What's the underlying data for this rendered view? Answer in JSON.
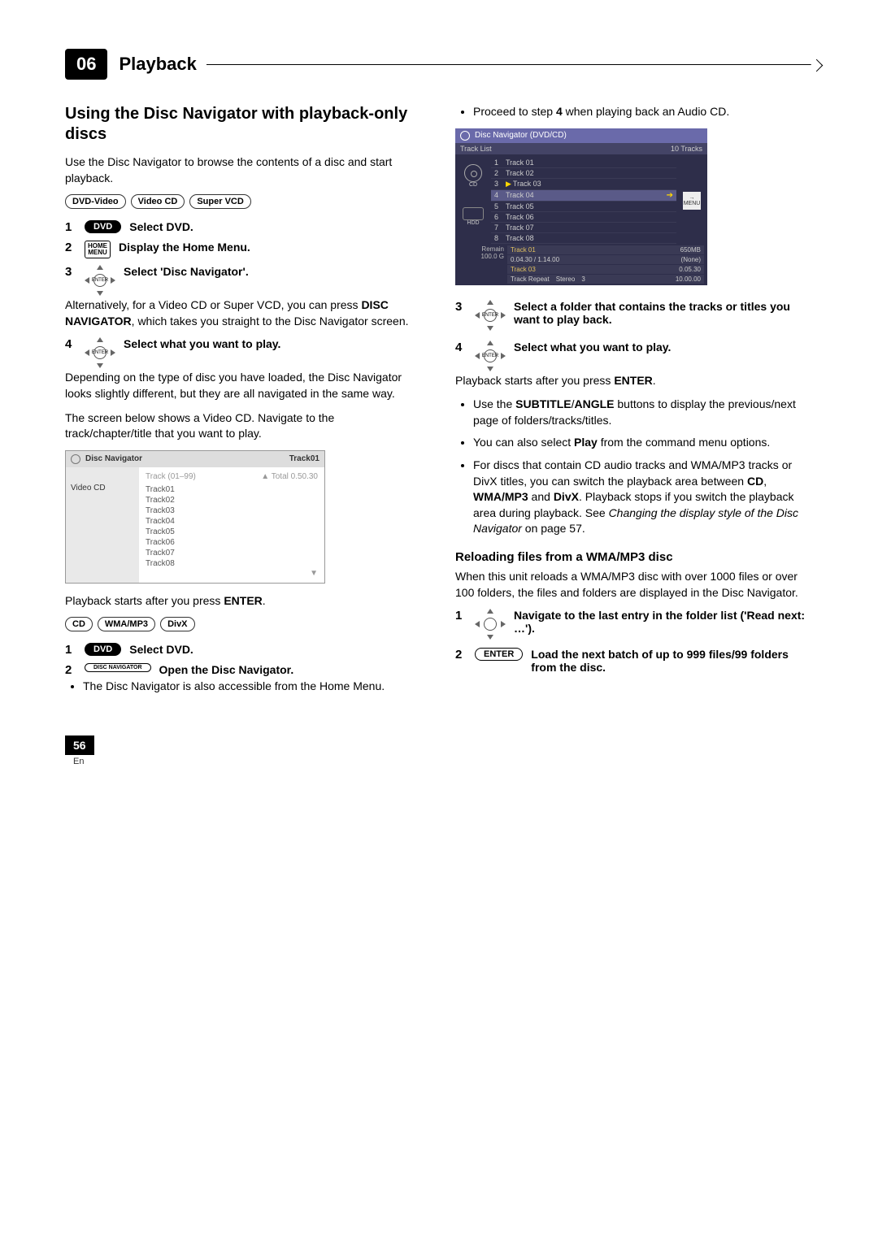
{
  "chapter": {
    "number": "06",
    "title": "Playback"
  },
  "left": {
    "h2": "Using the Disc Navigator with playback-only discs",
    "intro": "Use the Disc Navigator to browse the contents of a disc and start playback.",
    "badges1": [
      "DVD-Video",
      "Video CD",
      "Super VCD"
    ],
    "s1": {
      "num": "1",
      "btn": "DVD",
      "text": "Select DVD."
    },
    "s2": {
      "num": "2",
      "btn": "HOME\nMENU",
      "text": "Display the Home Menu."
    },
    "s3": {
      "num": "3",
      "center": "ENTER",
      "text": "Select 'Disc Navigator'."
    },
    "s3_follow": "Alternatively, for a Video CD or Super VCD, you can press <b>DISC NAVIGATOR</b>, which takes you straight to the Disc Navigator screen.",
    "s4": {
      "num": "4",
      "center": "ENTER",
      "text": "Select what you want to play."
    },
    "s4_follow1": "Depending on the type of disc you have loaded, the Disc Navigator looks slightly different, but they are all navigated in the same way.",
    "s4_follow2": "The screen below shows a Video CD. Navigate to the track/chapter/title that you want to play.",
    "vcd": {
      "header": "Disc Navigator",
      "trk": "Track01",
      "left_label": "Video CD",
      "meta_left": "Track (01–99)",
      "meta_right": "▲  Total 0.50.30",
      "tracks": [
        "Track01",
        "Track02",
        "Track03",
        "Track04",
        "Track05",
        "Track06",
        "Track07",
        "Track08"
      ],
      "down": "▼"
    },
    "after_vcd": "Playback starts after you press <b>ENTER</b>.",
    "badges2": [
      "CD",
      "WMA/MP3",
      "DivX"
    ],
    "s5": {
      "num": "1",
      "btn": "DVD",
      "text": "Select DVD."
    },
    "s6": {
      "num": "2",
      "btn": "DISC NAVIGATOR",
      "text": "Open the Disc Navigator."
    },
    "s6_bullet": "The Disc Navigator is also accessible from the Home Menu."
  },
  "right": {
    "top_bullet": "Proceed to step <b>4</b> when playing back an Audio CD.",
    "dvd": {
      "title": "Disc Navigator (DVD/CD)",
      "sub_left": "Track List",
      "sub_right": "10 Tracks",
      "cd_label": "CD",
      "tracks": [
        {
          "n": "1",
          "t": "Track 01"
        },
        {
          "n": "2",
          "t": "Track 02"
        },
        {
          "n": "3",
          "t": "Track 03",
          "play": true
        },
        {
          "n": "4",
          "t": "Track 04",
          "sel": true
        },
        {
          "n": "5",
          "t": "Track 05"
        },
        {
          "n": "6",
          "t": "Track 06"
        },
        {
          "n": "7",
          "t": "Track 07"
        },
        {
          "n": "8",
          "t": "Track 08"
        }
      ],
      "menu": "MENU",
      "hdd_label": "HDD",
      "foot_l1": "Remain",
      "foot_l2": "100.0 G",
      "foot_r1_a": "Track 01",
      "foot_r1_b": "650MB",
      "foot_r2_a": "0.04.30 / 1.14.00",
      "foot_r2_b": "(None)",
      "foot_r3_a": "Track 03",
      "foot_r3_b": "0.05.30",
      "foot_r4_a": "Track Repeat",
      "foot_r4_b": "Stereo",
      "foot_r4_c": "3",
      "foot_r4_d": "10.00.00"
    },
    "s3r": {
      "num": "3",
      "center": "ENTER",
      "text": "Select a folder that contains the tracks or titles you want to play back."
    },
    "s4r": {
      "num": "4",
      "center": "ENTER",
      "text": "Select what you want to play."
    },
    "s4r_follow": "Playback starts after you press <b>ENTER</b>.",
    "bullets": [
      "Use the <b>SUBTITLE</b>/<b>ANGLE</b> buttons to display the previous/next page of folders/tracks/titles.",
      "You can also select <b>Play</b> from the command menu options.",
      "For discs that contain CD audio tracks and WMA/MP3 tracks or DivX titles, you can switch the playback area between <b>CD</b>, <b>WMA/MP3</b> and <b>DivX</b>. Playback stops if you switch the playback area during playback. See <em>Changing the display style of the Disc Navigator</em> on page 57."
    ],
    "h3": "Reloading files from a WMA/MP3 disc",
    "h3_follow": "When this unit reloads a WMA/MP3 disc with over 1000 files or over 100 folders, the files and folders are displayed in the Disc Navigator.",
    "rs1": {
      "num": "1",
      "text": "Navigate to the last entry in the folder list ('Read next: …')."
    },
    "rs2": {
      "num": "2",
      "btn": "ENTER",
      "text": "Load the next batch of up to 999 files/99 folders from the disc."
    }
  },
  "footer": {
    "page": "56",
    "lang": "En"
  }
}
